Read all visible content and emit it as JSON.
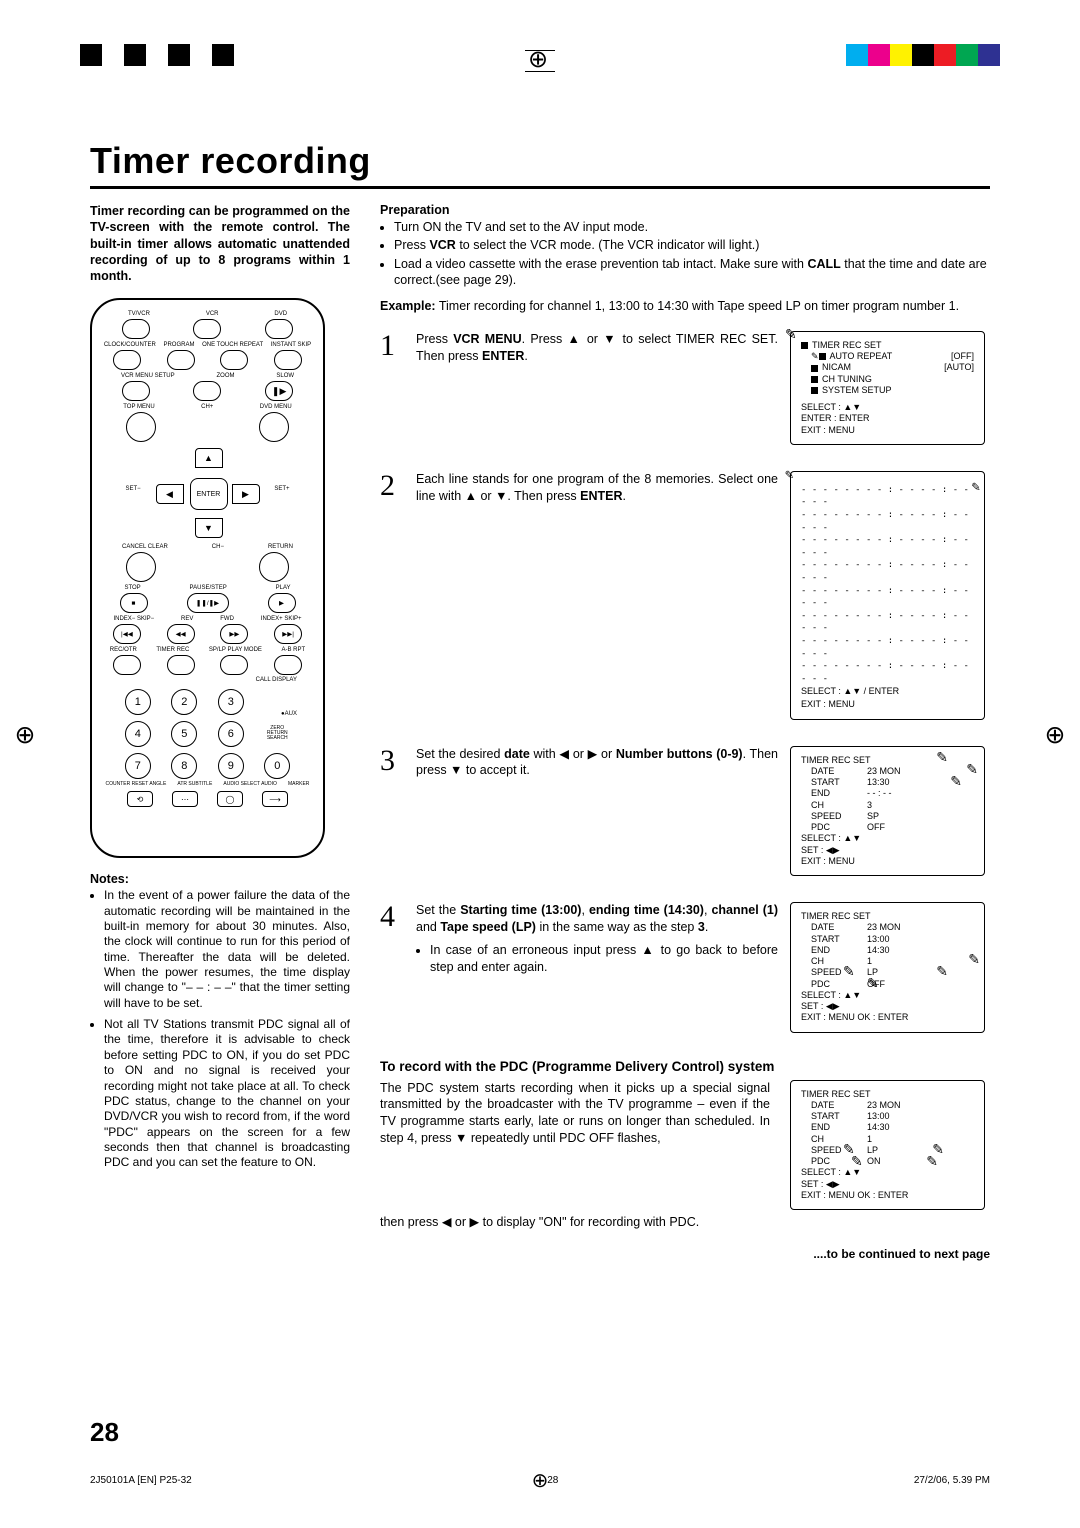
{
  "page": {
    "title": "Timer recording",
    "page_number": "28",
    "footer_left": "2J50101A [EN] P25-32",
    "footer_center_num": "28",
    "footer_right": "27/2/06, 5.39 PM",
    "continued": "....to be continued to next page"
  },
  "intro": "Timer recording can be programmed on the TV-screen with the remote control. The built-in timer allows automatic unattended recording of up to 8 programs within 1 month.",
  "remote_labels": {
    "row1": [
      "TV/VCR",
      "VCR",
      "DVD"
    ],
    "row2": [
      "CLOCK/COUNTER",
      "PROGRAM",
      "ONE TOUCH REPEAT",
      "INSTANT SKIP"
    ],
    "row3": [
      "VCR MENU SETUP",
      "ZOOM",
      "SLOW"
    ],
    "row4": [
      "TOP MENU",
      "CH+",
      "DVD MENU"
    ],
    "nav": {
      "left": "SET−",
      "center": "ENTER",
      "right": "SET+",
      "up_icon": "▲",
      "down_icon": "▼",
      "left_icon": "◀",
      "right_icon": "▶"
    },
    "row5": [
      "CANCEL CLEAR",
      "CH−",
      "RETURN"
    ],
    "transport": [
      "STOP",
      "PAUSE/STEP",
      "PLAY"
    ],
    "transport_icons": [
      "■",
      "❚❚/❚▶",
      "▶"
    ],
    "skip": [
      "INDEX− SKIP−",
      "REV",
      "FWD",
      "INDEX+ SKIP+"
    ],
    "skip_icons": [
      "|◀◀",
      "◀◀",
      "▶▶",
      "▶▶|"
    ],
    "bottom": [
      "REC/OTR",
      "TIMER REC",
      "SP/LP PLAY MODE",
      "A-B RPT"
    ],
    "call": "CALL DISPLAY",
    "zero": "ZERO RETURN SEARCH",
    "aux": "●AUX",
    "lower": [
      "COUNTER RESET ANGLE",
      "ATR SUBTITLE",
      "AUDIO SELECT AUDIO",
      "MARKER"
    ]
  },
  "notes_heading": "Notes:",
  "notes": [
    "In the event of a power failure the data of the automatic recording will be maintained in the built-in memory for about 30 minutes. Also, the clock will continue to run for this period of time. Thereafter the data will be deleted. When the power resumes, the time display will change to \"– – : – –\" that the timer setting will have to be set.",
    "Not all TV Stations transmit PDC signal all of the time, therefore it is advisable to check before setting PDC to ON, if you do set PDC to ON and no signal is received your recording might not take place at all. To check PDC status, change to the channel on your DVD/VCR you wish to record from, if the word \"PDC\" appears on the screen for a few seconds then that channel is broadcasting PDC and you can set the feature to ON."
  ],
  "prep_heading": "Preparation",
  "preparation": [
    "Turn ON the TV and set to the AV input mode.",
    "Press VCR to select the VCR mode. (The VCR indicator will light.)",
    "Load a video cassette with the erase prevention tab intact. Make sure with CALL that the time and date are correct.(see page 29)."
  ],
  "example_label": "Example:",
  "example_text": " Timer recording for channel 1, 13:00 to 14:30 with Tape speed LP on timer program number 1.",
  "steps": [
    {
      "num": "1",
      "text_pre": "Press ",
      "text_b1": "VCR MENU",
      "text_mid": ". Press ▲ or ▼ to select  TIMER REC SET. Then press ",
      "text_b2": "ENTER",
      "text_post": "."
    },
    {
      "num": "2",
      "text": "Each line stands for one program of the 8 memories. Select one line with ▲ or ▼. Then press ",
      "text_b": "ENTER",
      "text_post": "."
    },
    {
      "num": "3",
      "text_pre": "Set the desired ",
      "text_b1": "date",
      "text_mid1": " with ◀ or ▶ or ",
      "text_b2": "Number buttons (0-9)",
      "text_post": ". Then press ▼ to accept it."
    },
    {
      "num": "4",
      "text_pre": "Set the ",
      "text_b1": "Starting time (13:00)",
      "text_mid1": ", ",
      "text_b2": "ending time (14:30)",
      "text_mid2": ", ",
      "text_b3": "channel (1)",
      "text_mid3": " and ",
      "text_b4": "Tape speed (LP)",
      "text_post": " in the same way as the step ",
      "text_b5": "3",
      "text_end": ".",
      "sub": "In case of an erroneous input press ▲ to go back to before step and enter again."
    }
  ],
  "osd1": {
    "title": "TIMER REC SET",
    "items": [
      {
        "label": "AUTO REPEAT",
        "value": "[OFF]"
      },
      {
        "label": "NICAM",
        "value": "[AUTO]"
      },
      {
        "label": "CH TUNING",
        "value": ""
      },
      {
        "label": "SYSTEM SETUP",
        "value": ""
      }
    ],
    "foot": [
      "SELECT  : ▲▼",
      "ENTER    : ENTER",
      "EXIT        : MENU"
    ]
  },
  "osd2": {
    "slots_line": "- - - - - -   - - : - -   - - : - -   - -  -",
    "count": 8,
    "foot": [
      "SELECT : ▲▼ / ENTER",
      "EXIT : MENU"
    ]
  },
  "osd3": {
    "title": "TIMER REC SET",
    "kv": [
      {
        "k": "DATE",
        "v": "23 MON"
      },
      {
        "k": "START",
        "v": "13:30"
      },
      {
        "k": "END",
        "v": "- - : - -"
      },
      {
        "k": "CH",
        "v": "3"
      },
      {
        "k": "SPEED",
        "v": "SP"
      },
      {
        "k": "PDC",
        "v": "OFF"
      }
    ],
    "foot": [
      "SELECT : ▲▼",
      "SET        : ◀▶",
      "EXIT       : MENU"
    ]
  },
  "osd4": {
    "title": "TIMER REC SET",
    "kv": [
      {
        "k": "DATE",
        "v": "23 MON"
      },
      {
        "k": "START",
        "v": "13:00"
      },
      {
        "k": "END",
        "v": "14:30"
      },
      {
        "k": "CH",
        "v": "1"
      },
      {
        "k": "SPEED",
        "v": "LP"
      },
      {
        "k": "PDC",
        "v": "OFF"
      }
    ],
    "foot": [
      "SELECT : ▲▼",
      "SET        : ◀▶",
      "EXIT       : MENU     OK : ENTER"
    ]
  },
  "pdc_heading": "To record with the PDC (Programme Delivery Control) system",
  "pdc_text": "The PDC system starts recording when it picks up a special signal transmitted by the broadcaster with the TV programme – even if the TV programme starts early, late or runs on longer than scheduled. In step 4, press ▼ repeatedly until PDC OFF flashes,",
  "pdc_after": "then press ◀ or ▶ to display \"ON\" for recording with PDC.",
  "osd5": {
    "title": "TIMER REC SET",
    "kv": [
      {
        "k": "DATE",
        "v": "23 MON"
      },
      {
        "k": "START",
        "v": "13:00"
      },
      {
        "k": "END",
        "v": "14:30"
      },
      {
        "k": "CH",
        "v": "1"
      },
      {
        "k": "SPEED",
        "v": "LP"
      },
      {
        "k": "PDC",
        "v": "ON"
      }
    ],
    "foot": [
      "SELECT : ▲▼",
      "SET        : ◀▶",
      "EXIT       : MENU     OK : ENTER"
    ]
  }
}
